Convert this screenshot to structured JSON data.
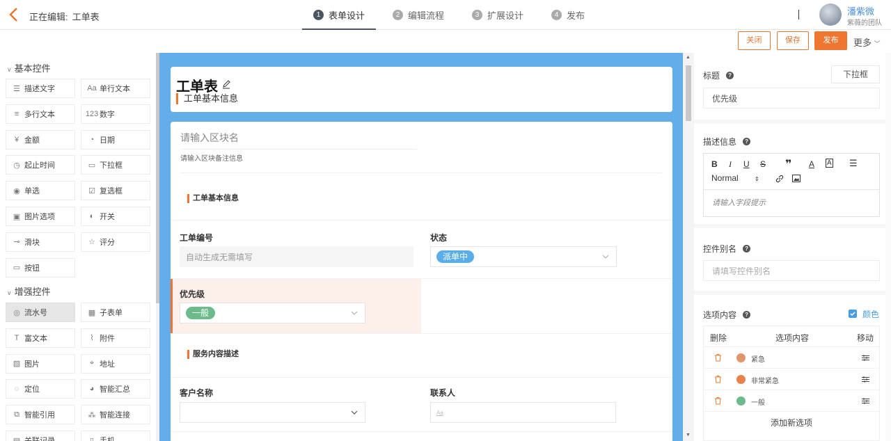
{
  "header": {
    "editing_label": "正在编辑:",
    "form_name": "工单表",
    "steps": [
      {
        "num": "1",
        "label": "表单设计"
      },
      {
        "num": "2",
        "label": "编辑流程"
      },
      {
        "num": "3",
        "label": "扩展设计"
      },
      {
        "num": "4",
        "label": "发布"
      }
    ],
    "user_name": "潘紫微",
    "user_team": "紫薇的团队"
  },
  "actions": {
    "close": "关闭",
    "save": "保存",
    "publish": "发布",
    "more": "更多"
  },
  "left": {
    "basic_title": "基本控件",
    "enhanced_title": "增强控件",
    "basic": [
      {
        "label": "描述文字",
        "icon": "description-icon"
      },
      {
        "label": "单行文本",
        "icon": "single-line-icon"
      },
      {
        "label": "多行文本",
        "icon": "multi-line-icon"
      },
      {
        "label": "数字",
        "icon": "number-icon"
      },
      {
        "label": "金额",
        "icon": "money-icon"
      },
      {
        "label": "日期",
        "icon": "date-icon"
      },
      {
        "label": "起止时间",
        "icon": "time-range-icon"
      },
      {
        "label": "下拉框",
        "icon": "dropdown-icon"
      },
      {
        "label": "单选",
        "icon": "radio-icon"
      },
      {
        "label": "复选框",
        "icon": "checkbox-icon"
      },
      {
        "label": "图片选项",
        "icon": "image-option-icon"
      },
      {
        "label": "开关",
        "icon": "switch-icon"
      },
      {
        "label": "滑块",
        "icon": "slider-icon"
      },
      {
        "label": "评分",
        "icon": "star-icon"
      },
      {
        "label": "按钮",
        "icon": "button-icon"
      }
    ],
    "enhanced": [
      {
        "label": "流水号",
        "icon": "serial-icon"
      },
      {
        "label": "子表单",
        "icon": "subform-icon"
      },
      {
        "label": "富文本",
        "icon": "richtext-icon"
      },
      {
        "label": "附件",
        "icon": "attachment-icon"
      },
      {
        "label": "图片",
        "icon": "image-icon"
      },
      {
        "label": "地址",
        "icon": "address-icon"
      },
      {
        "label": "定位",
        "icon": "location-icon"
      },
      {
        "label": "智能汇总",
        "icon": "summary-icon"
      },
      {
        "label": "智能引用",
        "icon": "reference-icon"
      },
      {
        "label": "智能连接",
        "icon": "connect-icon"
      },
      {
        "label": "关联记录",
        "icon": "related-icon"
      },
      {
        "label": "手机",
        "icon": "phone-icon"
      }
    ]
  },
  "form": {
    "title": "工单表",
    "subtitle": "工单基本信息",
    "block_name_placeholder": "请输入区块名",
    "block_note_placeholder": "请输入区块备注信息",
    "section1": "工单基本信息",
    "ticket_no_label": "工单编号",
    "ticket_no_placeholder": "自动生成无需填写",
    "status_label": "状态",
    "status_value": "派单中",
    "priority_label": "优先级",
    "priority_value": "一般",
    "section2": "服务内容描述",
    "customer_label": "客户名称",
    "contact_label": "联系人",
    "contact_icon_text": "Aa"
  },
  "props": {
    "title_label": "标题",
    "control_type": "下拉框",
    "title_value": "优先级",
    "desc_label": "描述信息",
    "format_value": "Normal",
    "desc_placeholder": "请输入字段提示",
    "alias_label": "控件别名",
    "alias_placeholder": "请填写控件别名",
    "options_label": "选项内容",
    "color_label": "颜色",
    "col_delete": "删除",
    "col_content": "选项内容",
    "col_move": "移动",
    "options": [
      {
        "label": "紧急",
        "color": "#e0956a"
      },
      {
        "label": "非常紧急",
        "color": "#e8824a"
      },
      {
        "label": "一般",
        "color": "#6dbb8a"
      }
    ],
    "add_option": "添加新选项"
  },
  "colors": {
    "accent": "#ee7630",
    "canvas": "#62adea",
    "status_tag": "#5aaee8",
    "priority_tag": "#6dbb8a"
  }
}
